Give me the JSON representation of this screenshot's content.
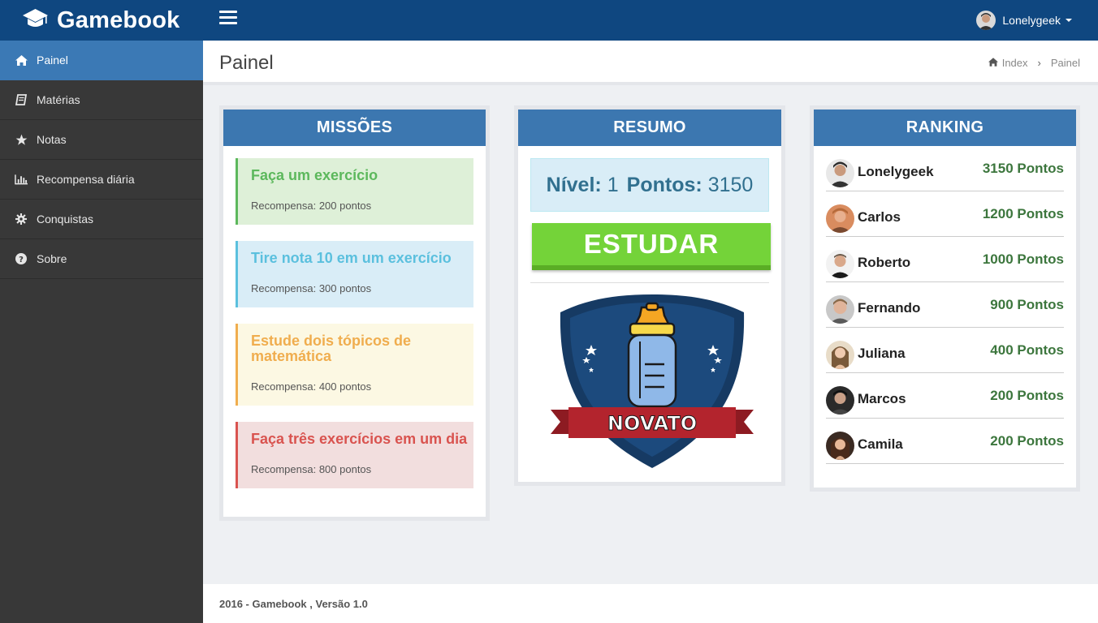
{
  "app": {
    "brand": "Gamebook"
  },
  "user": {
    "name": "Lonelygeek"
  },
  "sidebar": {
    "items": [
      {
        "label": "Painel",
        "icon": "home-icon"
      },
      {
        "label": "Matérias",
        "icon": "book-icon"
      },
      {
        "label": "Notas",
        "icon": "star-icon"
      },
      {
        "label": "Recompensa diária",
        "icon": "bar-chart-icon"
      },
      {
        "label": "Conquistas",
        "icon": "gear-icon"
      },
      {
        "label": "Sobre",
        "icon": "question-icon"
      }
    ]
  },
  "page": {
    "title": "Painel",
    "breadcrumb": [
      "Index",
      "Painel"
    ]
  },
  "missions": {
    "title": "MISSÕES",
    "items": [
      {
        "title": "Faça um exercício",
        "reward": "Recompensa: 200 pontos"
      },
      {
        "title": "Tire nota 10 em um exercício",
        "reward": "Recompensa: 300 pontos"
      },
      {
        "title": "Estude dois tópicos de matemática",
        "reward": "Recompensa: 400 pontos"
      },
      {
        "title": "Faça três exercícios em um dia",
        "reward": "Recompensa: 800 pontos"
      }
    ]
  },
  "summary": {
    "title": "RESUMO",
    "level_label": "Nível:",
    "level": "1",
    "points_label": "Pontos:",
    "points": "3150",
    "study_button": "ESTUDAR",
    "badge_text": "NOVATO"
  },
  "ranking": {
    "title": "RANKING",
    "rows": [
      {
        "name": "Lonelygeek",
        "points": "3150 Pontos"
      },
      {
        "name": "Carlos",
        "points": "1200 Pontos"
      },
      {
        "name": "Roberto",
        "points": "1000 Pontos"
      },
      {
        "name": "Fernando",
        "points": "900 Pontos"
      },
      {
        "name": "Juliana",
        "points": "400 Pontos"
      },
      {
        "name": "Marcos",
        "points": "200 Pontos"
      },
      {
        "name": "Camila",
        "points": "200 Pontos"
      }
    ]
  },
  "footer": {
    "text": "2016 - Gamebook , Versão 1.0"
  },
  "colors": {
    "topbar": "#0f4780",
    "sidebar": "#383838",
    "sidebar_active": "#3b79b5",
    "panel_header": "#3c77b0",
    "study_button": "#74d339",
    "points_text": "#3c763d"
  }
}
